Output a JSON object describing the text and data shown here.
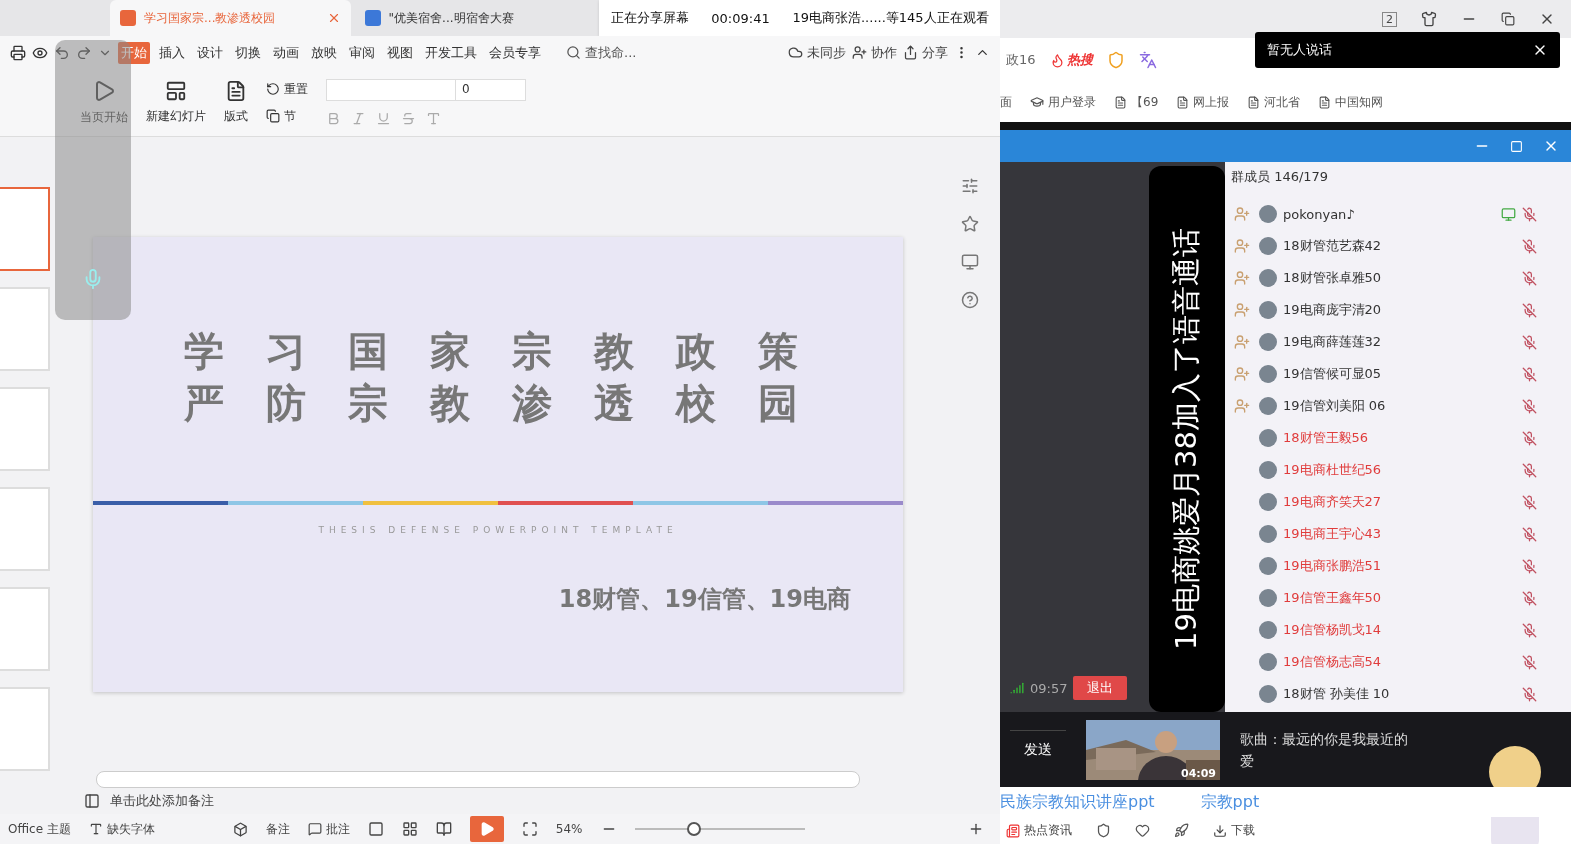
{
  "wps": {
    "tabs": [
      {
        "label": "学习国家宗...教渗透校园",
        "kind": "presentation",
        "selected": true
      },
      {
        "label": "\"优美宿舍...明宿舍大赛",
        "kind": "writer",
        "selected": false
      }
    ],
    "share_bar": {
      "status": "正在分享屏幕",
      "time": "00:09:41",
      "viewers": "19电商张浩......等145人正在观看"
    },
    "menu": [
      {
        "label": "开始",
        "selected": true
      },
      {
        "label": "插入",
        "selected": false
      },
      {
        "label": "设计",
        "selected": false
      },
      {
        "label": "切换",
        "selected": false
      },
      {
        "label": "动画",
        "selected": false
      },
      {
        "label": "放映",
        "selected": false
      },
      {
        "label": "审阅",
        "selected": false
      },
      {
        "label": "视图",
        "selected": false
      },
      {
        "label": "开发工具",
        "selected": false
      },
      {
        "label": "会员专享",
        "selected": false
      }
    ],
    "search": {
      "placeholder": "查找命..."
    },
    "actions": [
      "未同步",
      "协作",
      "分享"
    ],
    "ribbon": {
      "play": "当页开始",
      "new_slide": "新建幻灯片",
      "layout": "版式",
      "reset": "重置",
      "section": "节",
      "font_size": "0"
    },
    "slide": {
      "title_lines": [
        "学 习 国 家 宗 教 政 策",
        "严 防 宗 教 渗 透 校 园"
      ],
      "subtitle": "THESIS DEFENSE POWERPOINT TEMPLATE",
      "classes": "18财管、19信管、19电商"
    },
    "notes": {
      "placeholder": "单击此处添加备注"
    },
    "status": {
      "theme": "Office 主题",
      "font": "缺失字体",
      "notes": "备注",
      "comments": "批注",
      "zoom": "54%",
      "zoom_slider": {
        "level": 0.35
      }
    }
  },
  "right": {
    "window_counter": "2",
    "browser_text": "政16",
    "hot": "热搜",
    "toast": "暂无人说话",
    "bookmarks": [
      "面",
      "用户登录",
      "【69",
      "网上报",
      "河北省",
      "中国知网"
    ],
    "members_title": "群成员 146/179",
    "members": [
      {
        "name": "pokonyan♪",
        "admin": true,
        "sharing": true,
        "color": "#333333"
      },
      {
        "name": "18财管范艺森42",
        "admin": true,
        "sharing": false,
        "color": "#333333"
      },
      {
        "name": "18财管张卓雅50",
        "admin": true,
        "sharing": false,
        "color": "#333333"
      },
      {
        "name": "19电商庞宇清20",
        "admin": true,
        "sharing": false,
        "color": "#333333"
      },
      {
        "name": "19电商薛莲莲32",
        "admin": true,
        "sharing": false,
        "color": "#333333"
      },
      {
        "name": "19信管候可显05",
        "admin": true,
        "sharing": false,
        "color": "#333333"
      },
      {
        "name": "19信管刘美阳 06",
        "admin": true,
        "sharing": false,
        "color": "#333333"
      },
      {
        "name": "18财管王毅56",
        "admin": false,
        "sharing": false,
        "color": "#e03c3c"
      },
      {
        "name": "19电商杜世纪56",
        "admin": false,
        "sharing": false,
        "color": "#e03c3c"
      },
      {
        "name": "19电商齐笑天27",
        "admin": false,
        "sharing": false,
        "color": "#e03c3c"
      },
      {
        "name": "19电商王宇心43",
        "admin": false,
        "sharing": false,
        "color": "#e03c3c"
      },
      {
        "name": "19电商张鹏浩51",
        "admin": false,
        "sharing": false,
        "color": "#e03c3c"
      },
      {
        "name": "19信管王鑫年50",
        "admin": false,
        "sharing": false,
        "color": "#e03c3c"
      },
      {
        "name": "19信管杨凯戈14",
        "admin": false,
        "sharing": false,
        "color": "#e03c3c"
      },
      {
        "name": "19信管杨志高54",
        "admin": false,
        "sharing": false,
        "color": "#e03c3c"
      },
      {
        "name": "18财管 孙美佳 10",
        "admin": false,
        "sharing": false,
        "color": "#333333"
      }
    ],
    "call_time": "09:57",
    "exit": "退出",
    "notice": "19电商姚爱月38加入了语音通话",
    "send": "发送",
    "video": {
      "kind": "picture",
      "duration": "04:09",
      "title": "歌曲：最远的你是我最近的爱"
    },
    "links": [
      "民族宗教知识讲座ppt",
      "宗教ppt"
    ],
    "bottom": [
      "热点资讯",
      "下载"
    ]
  }
}
